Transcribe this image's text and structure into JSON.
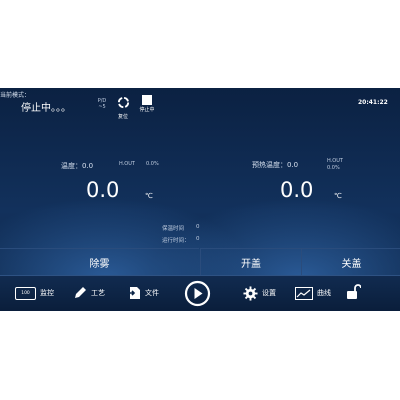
{
  "status": {
    "mode_label": "当前模式：",
    "mode_value": "停止中。。。",
    "time": "20:41:22",
    "icon_small_label": "P/D\n~5",
    "reset_label": "复位",
    "stop_label": "停止中"
  },
  "left": {
    "temp_label": "温度：0.0",
    "hout_label": "H.OUT",
    "hout_value": "0.0%",
    "big_value": "0.0",
    "unit": "℃"
  },
  "right": {
    "temp_label": "预热温度：0.0",
    "hout_label": "H.OUT",
    "hout_value": "0.0%",
    "big_value": "0.0",
    "unit": "℃"
  },
  "timers": {
    "hold_label": "保温时间",
    "hold_value": "0",
    "run_label": "运行时间：",
    "run_value": "0"
  },
  "commands": {
    "defog": "除雾",
    "open_lid": "开盖",
    "close_lid": "关盖"
  },
  "nav": {
    "monitor": "监控",
    "monitor_badge": "100",
    "process": "工艺",
    "file": "文件",
    "settings": "设置",
    "curve": "曲线"
  }
}
